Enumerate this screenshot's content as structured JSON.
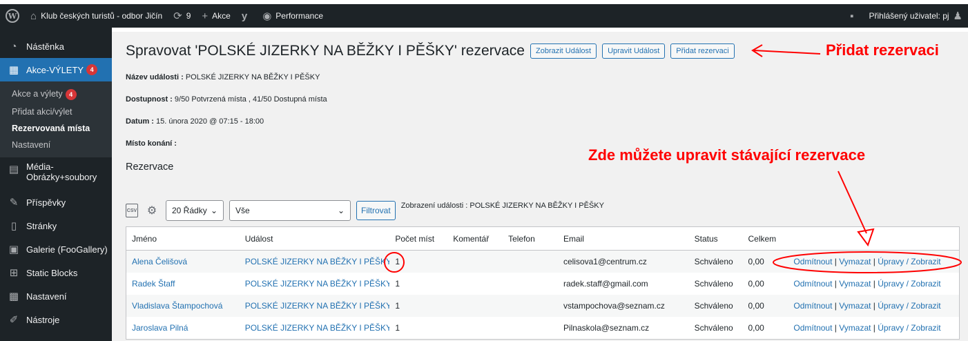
{
  "adminbar": {
    "site_name": "Klub českých turistů - odbor Jičín",
    "updates_count": "9",
    "new_label": "Akce",
    "performance_label": "Performance",
    "user_label": "Přihlášený uživatel: pj"
  },
  "sidebar": {
    "dashboard": "Nástěnka",
    "events": "Akce-VÝLETY",
    "events_badge": "4",
    "sub_items": [
      {
        "label": "Akce a výlety",
        "badge": "4"
      },
      {
        "label": "Přidat akci/výlet"
      },
      {
        "label": "Rezervovaná místa"
      },
      {
        "label": "Nastavení"
      }
    ],
    "media_line1": "Média-",
    "media_line2": "Obrázky+soubory",
    "posts": "Příspěvky",
    "pages": "Stránky",
    "gallery": "Galerie (FooGallery)",
    "static_blocks": "Static Blocks",
    "settings": "Nastavení",
    "tools": "Nástroje"
  },
  "header": {
    "title": "Spravovat 'POLSKÉ JIZERKY NA BĚŽKY I PĚŠKY' rezervace",
    "btn_view": "Zobrazit Událost",
    "btn_edit": "Upravit Událost",
    "btn_add": "Přidat rezervaci"
  },
  "meta": {
    "name_label": "Název události :",
    "name_value": "POLSKÉ JIZERKY NA BĚŽKY I PĚŠKY",
    "avail_label": "Dostupnost :",
    "avail_value": "9/50 Potvrzená místa , 41/50 Dostupná místa",
    "date_label": "Datum :",
    "date_value": "15. února 2020 @ 07:15 - 18:00",
    "place_label": "Místo konání :"
  },
  "section_title": "Rezervace",
  "filters": {
    "rows_select": "20 Řádky",
    "status_select": "Vše",
    "filter_button": "Filtrovat",
    "showing_text": "Zobrazení události : POLSKÉ JIZERKY NA BĚŽKY I PĚŠKY"
  },
  "table": {
    "headers": [
      "Jméno",
      "Událost",
      "Počet míst",
      "Komentář",
      "Telefon",
      "Email",
      "Status",
      "Celkem"
    ],
    "action_reject": "Odmítnout",
    "action_delete": "Vymazat",
    "action_edit": "Úpravy / Zobrazit",
    "rows": [
      {
        "name": "Alena Čelišová",
        "event": "POLSKÉ JIZERKY NA BĚŽKY I PĚŠKY",
        "spaces": "1",
        "email": "celisova1@centrum.cz",
        "status": "Schváleno",
        "total": "0,00"
      },
      {
        "name": "Radek Štaff",
        "event": "POLSKÉ JIZERKY NA BĚŽKY I PĚŠKY",
        "spaces": "1",
        "email": "radek.staff@gmail.com",
        "status": "Schváleno",
        "total": "0,00"
      },
      {
        "name": "Vladislava Štampochová",
        "event": "POLSKÉ JIZERKY NA BĚŽKY I PĚŠKY",
        "spaces": "1",
        "email": "vstampochova@seznam.cz",
        "status": "Schváleno",
        "total": "0,00"
      },
      {
        "name": "Jaroslava Pilná",
        "event": "POLSKÉ JIZERKY NA BĚŽKY I PĚŠKY",
        "spaces": "1",
        "email": "Pilnaskola@seznam.cz",
        "status": "Schváleno",
        "total": "0,00"
      }
    ]
  },
  "annotations": {
    "add_booking": "Přidat rezervaci",
    "edit_existing": "Zde můžete upravit stávající rezervace",
    "color": "#ff0000"
  }
}
